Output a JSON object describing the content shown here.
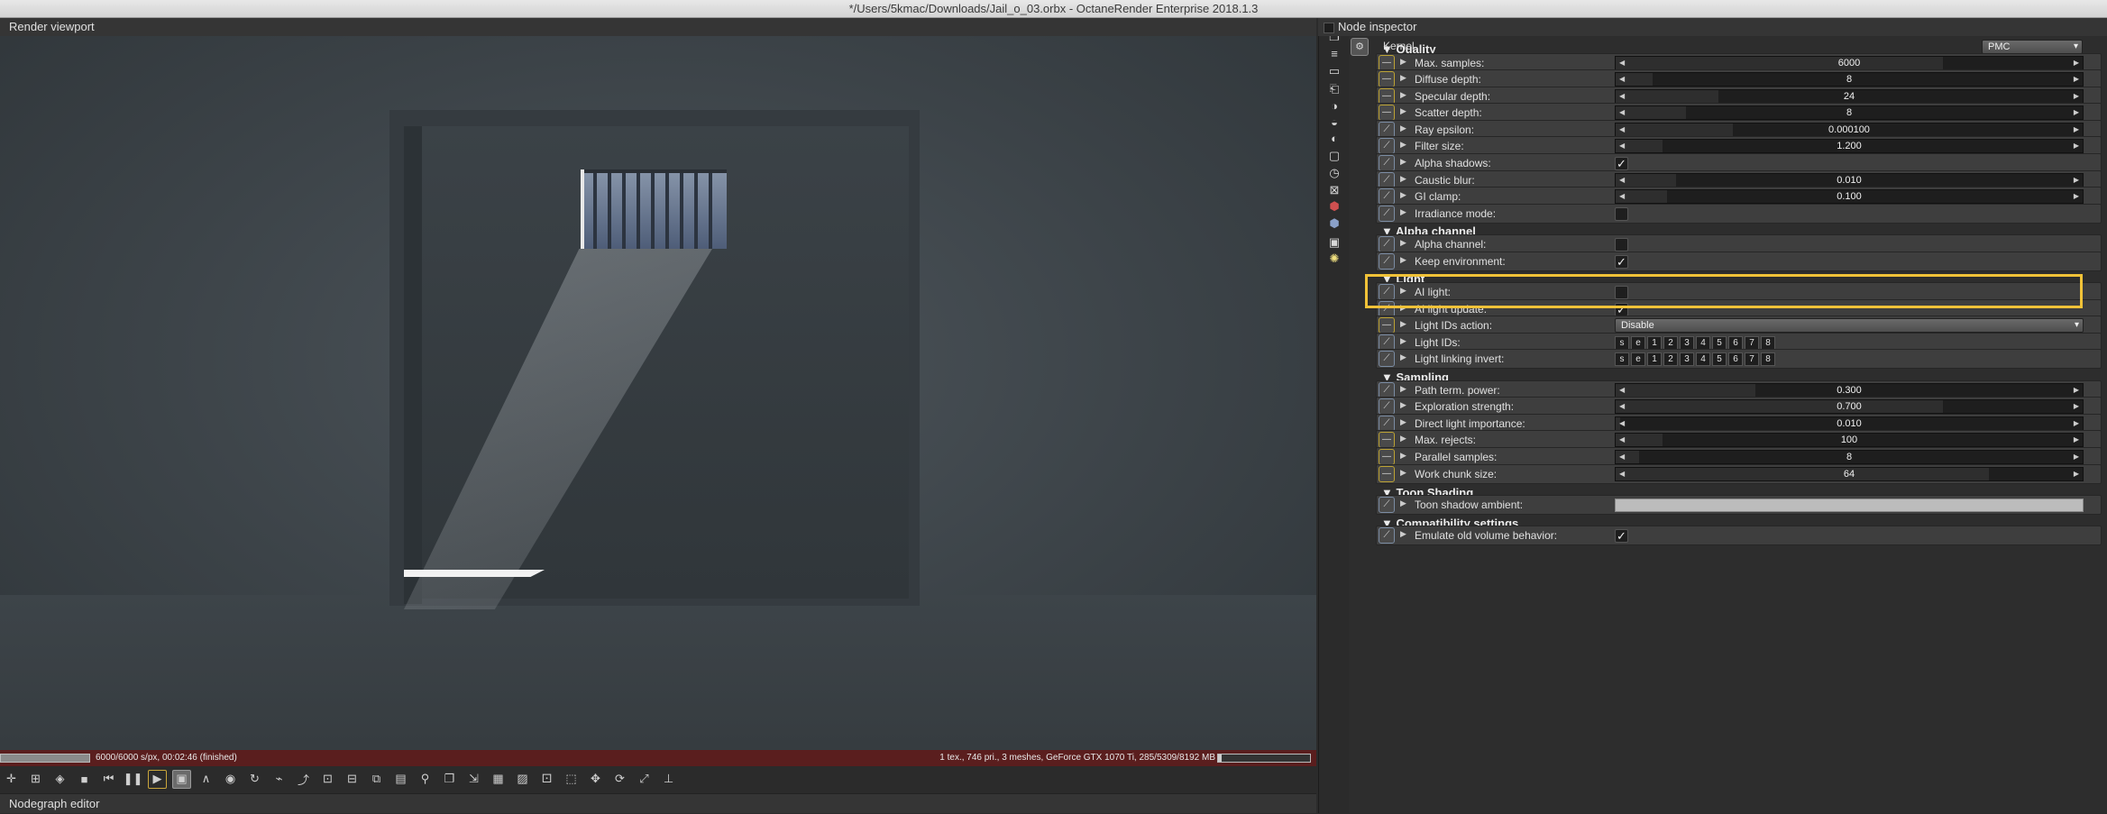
{
  "window": {
    "title": "*/Users/5kmac/Downloads/Jail_o_03.orbx - OctaneRender Enterprise 2018.1.3"
  },
  "viewport": {
    "title": "Render viewport",
    "status_left": "6000/6000 s/px, 00:02:46 (finished)",
    "status_right": "1 tex., 746 pri., 3 meshes, GeForce GTX 1070 Ti, 285/5309/8192 MB",
    "render_progress": 1.0
  },
  "nodegraph": {
    "title": "Nodegraph editor"
  },
  "inspector": {
    "title": "Node inspector",
    "kernel_label": "Kernel",
    "kernel_value": "PMC",
    "sections": {
      "quality": "▼ Quality",
      "alpha": "▼ Alpha channel",
      "light": "▼ Light",
      "sampling": "▼ Sampling",
      "toon": "▼ Toon Shading",
      "compat": "▼ Compatibility settings"
    },
    "rows": {
      "max_samples": {
        "label": "Max. samples:",
        "value": "6000",
        "fill": 0.7
      },
      "diffuse_depth": {
        "label": "Diffuse depth:",
        "value": "8",
        "fill": 0.08
      },
      "specular_depth": {
        "label": "Specular depth:",
        "value": "24",
        "fill": 0.22
      },
      "scatter_depth": {
        "label": "Scatter depth:",
        "value": "8",
        "fill": 0.15
      },
      "ray_epsilon": {
        "label": "Ray epsilon:",
        "value": "0.000100",
        "fill": 0.25
      },
      "filter_size": {
        "label": "Filter size:",
        "value": "1.200",
        "fill": 0.1
      },
      "alpha_shadows": {
        "label": "Alpha shadows:",
        "checked": "✓"
      },
      "caustic_blur": {
        "label": "Caustic blur:",
        "value": "0.010",
        "fill": 0.13
      },
      "gi_clamp": {
        "label": "GI clamp:",
        "value": "0.100",
        "fill": 0.11
      },
      "irradiance_mode": {
        "label": "Irradiance mode:",
        "checked": ""
      },
      "alpha_channel": {
        "label": "Alpha channel:",
        "checked": ""
      },
      "keep_environment": {
        "label": "Keep environment:",
        "checked": "✓"
      },
      "ai_light": {
        "label": "AI light:",
        "checked": ""
      },
      "ai_light_update": {
        "label": "AI light update:",
        "checked": "✓"
      },
      "light_ids_action": {
        "label": "Light IDs action:",
        "value": "Disable"
      },
      "light_ids": {
        "label": "Light IDs:"
      },
      "light_linking_invert": {
        "label": "Light linking invert:"
      },
      "path_term_power": {
        "label": "Path term. power:",
        "value": "0.300",
        "fill": 0.3
      },
      "exploration_strength": {
        "label": "Exploration strength:",
        "value": "0.700",
        "fill": 0.7
      },
      "direct_light_importance": {
        "label": "Direct light importance:",
        "value": "0.010",
        "fill": 0.01
      },
      "max_rejects": {
        "label": "Max. rejects:",
        "value": "100",
        "fill": 0.1
      },
      "parallel_samples": {
        "label": "Parallel samples:",
        "value": "8",
        "fill": 0.05
      },
      "work_chunk_size": {
        "label": "Work chunk size:",
        "value": "64",
        "fill": 0.8
      },
      "toon_shadow_ambient": {
        "label": "Toon shadow ambient:"
      },
      "emulate_old_volume": {
        "label": "Emulate old volume behavior:",
        "checked": "✓"
      }
    },
    "light_bits": [
      "s",
      "e",
      "1",
      "2",
      "3",
      "4",
      "5",
      "6",
      "7",
      "8"
    ]
  },
  "icons": [
    "viewport-icon",
    "stop-icon",
    "rewind-icon",
    "pause-icon",
    "play-icon",
    "camera-icon"
  ]
}
